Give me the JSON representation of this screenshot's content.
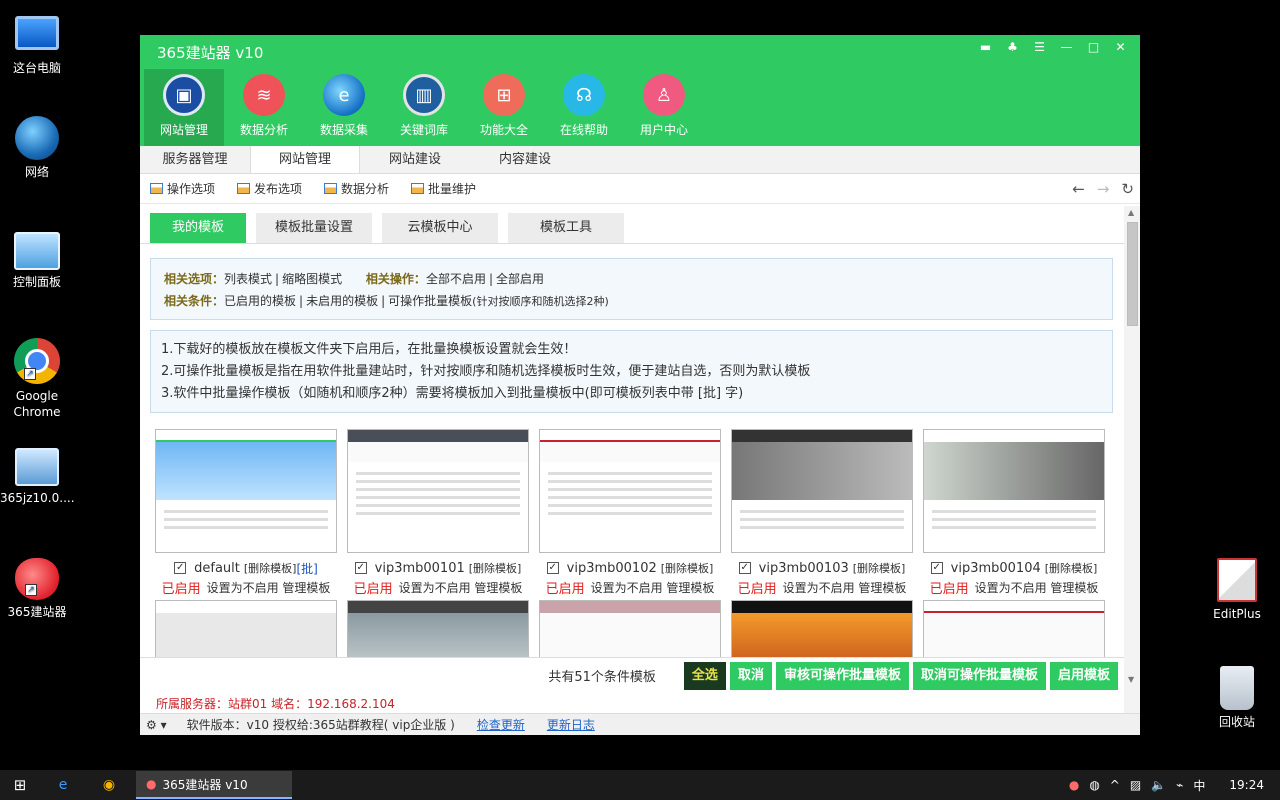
{
  "desktop": {
    "icons": [
      {
        "label": "这台电脑"
      },
      {
        "label": "网络"
      },
      {
        "label": "控制面板"
      },
      {
        "label": "Google Chrome"
      },
      {
        "label": "365jz10.0...."
      },
      {
        "label": "365建站器"
      },
      {
        "label": "EditPlus"
      },
      {
        "label": "回收站"
      }
    ]
  },
  "window": {
    "title": "365建站器 v10",
    "nav": [
      "网站管理",
      "数据分析",
      "数据采集",
      "关键词库",
      "功能大全",
      "在线帮助",
      "用户中心"
    ],
    "subtabs": [
      "服务器管理",
      "网站管理",
      "网站建设",
      "内容建设"
    ],
    "toolbar": [
      "操作选项",
      "发布选项",
      "数据分析",
      "批量维护"
    ],
    "tabs": [
      "我的模板",
      "模板批量设置",
      "云模板中心",
      "模板工具"
    ],
    "info": {
      "row1_label": "相关选项：",
      "row1_a": "列表模式",
      "row1_b": "缩略图模式",
      "row1_ops_label": "相关操作：",
      "row1_c": "全部不启用",
      "row1_d": "全部启用",
      "row2_label": "相关条件：",
      "row2_a": "已启用的模板",
      "row2_b": "未启用的模板",
      "row2_c": "可操作批量模板",
      "row2_c_note": "(针对按顺序和随机选择2种)"
    },
    "hints": [
      "1.下载好的模板放在模板文件夹下启用后，在批量换模板设置就会生效！",
      "2.可操作批量模板是指在用软件批量建站时，针对按顺序和随机选择模板时生效，便于建站自选，否则为默认模板",
      "3.软件中批量操作模板（如随机和顺序2种）需要将模板加入到批量模板中(即可模板列表中带 [批] 字)"
    ],
    "templates": [
      {
        "name": "default",
        "delete": "[删除模板]",
        "batch": "[批]"
      },
      {
        "name": "vip3mb00101",
        "delete": "[删除模板]",
        "batch": ""
      },
      {
        "name": "vip3mb00102",
        "delete": "[删除模板]",
        "batch": ""
      },
      {
        "name": "vip3mb00103",
        "delete": "[删除模板]",
        "batch": ""
      },
      {
        "name": "vip3mb00104",
        "delete": "[删除模板]",
        "batch": ""
      }
    ],
    "template_state": {
      "enabled": "已启用",
      "disable": "设置为不启用",
      "manage": "管理模板"
    },
    "footer": {
      "count": "共有51个条件模板",
      "select_all": "全选",
      "cancel": "取消",
      "audit": "审核可操作批量模板",
      "unaudit": "取消可操作批量模板",
      "enable": "启用模板"
    },
    "server": "所属服务器：站群01 域名：192.168.2.104",
    "status": {
      "version": "软件版本：v10",
      "license": "授权给:365站群教程( vip企业版 )",
      "check": "检查更新",
      "log": "更新日志"
    }
  },
  "taskbar": {
    "task": "365建站器 v10",
    "ime": "中",
    "time": "19:24"
  }
}
